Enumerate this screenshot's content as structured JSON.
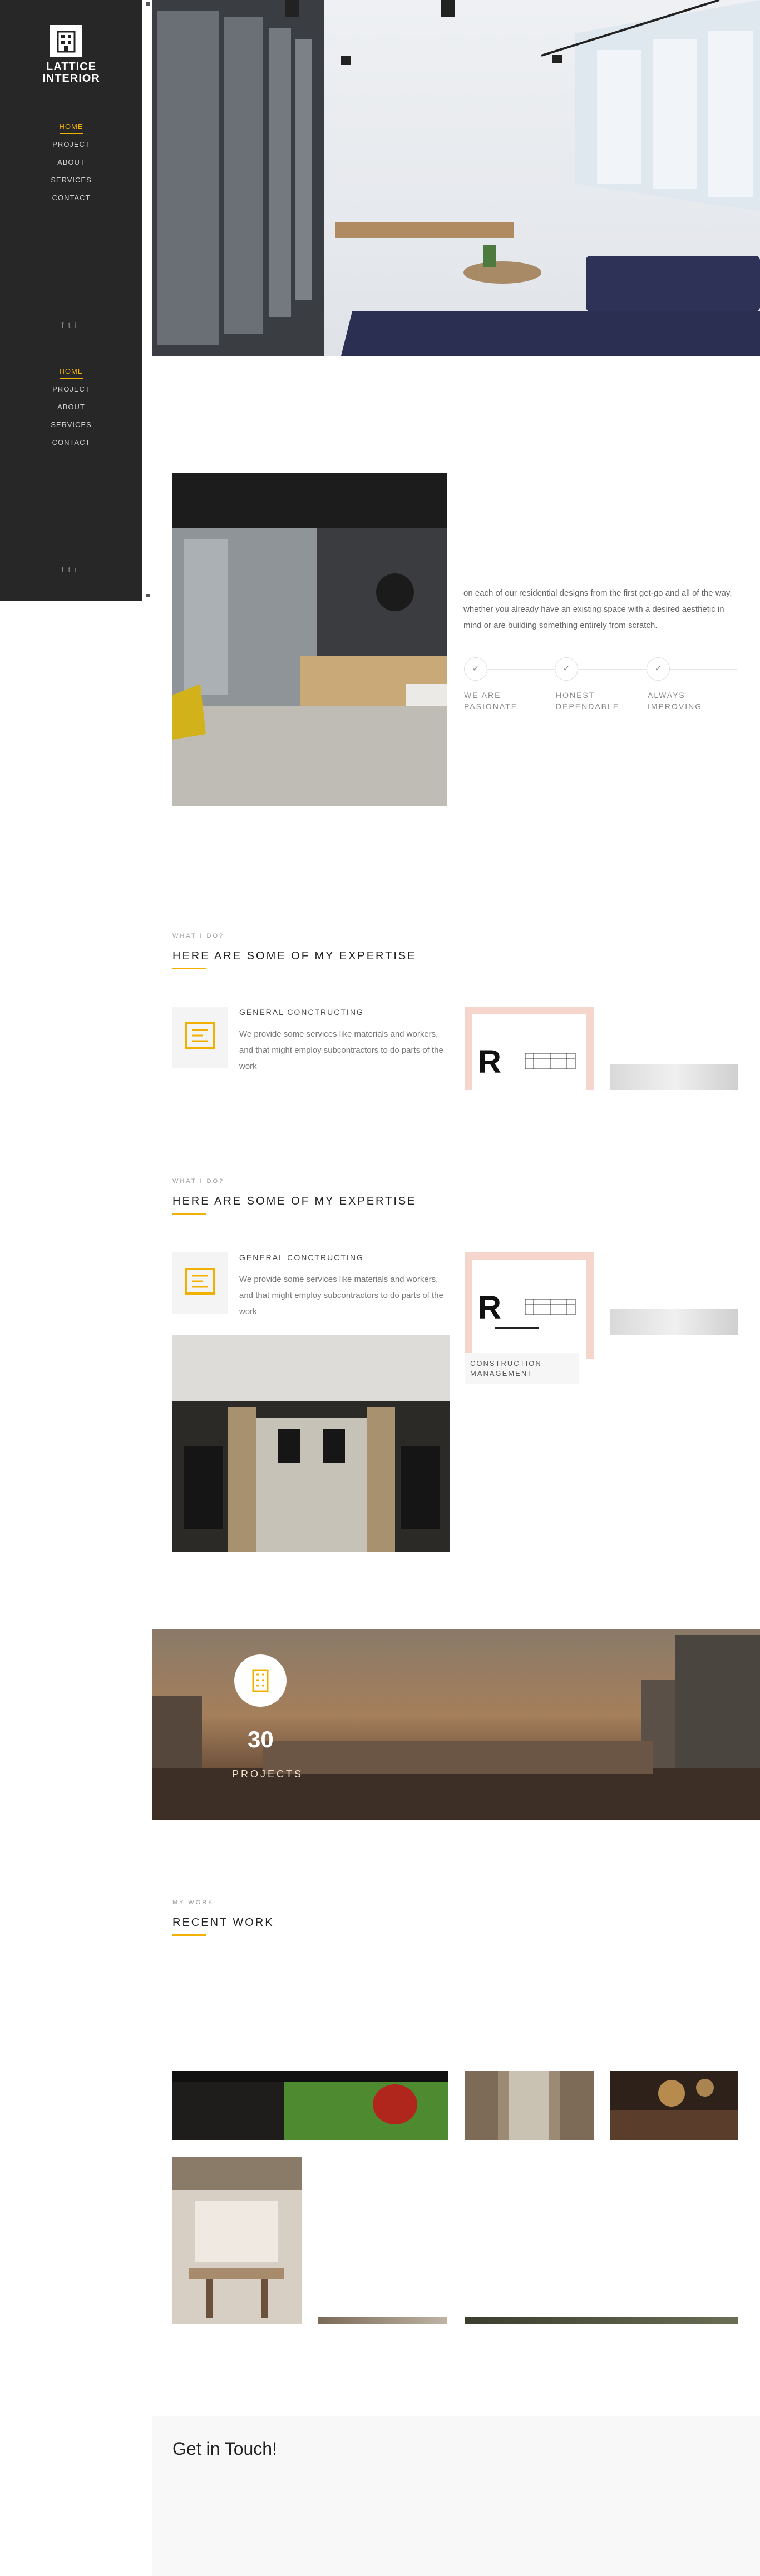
{
  "brand": {
    "line1": "LATTICE",
    "line2": "INTERIOR"
  },
  "nav": [
    "HOME",
    "PROJECT",
    "ABOUT",
    "SERVICES",
    "CONTACT"
  ],
  "nav_active": "HOME",
  "social": [
    "f",
    "t",
    "i"
  ],
  "about": {
    "text": "on each of our residential designs from the first get-go and all of the way, whether you already have an existing space with a desired aesthetic in mind or are building something entirely from scratch.",
    "features": [
      "WE ARE\nPASIONATE",
      "HONEST\nDEPENDABLE",
      "ALWAYS\nIMPROVING"
    ]
  },
  "expertise": {
    "kicker": "WHAT I DO?",
    "heading": "HERE ARE SOME OF MY EXPERTISE",
    "service_title": "GENERAL CONCTRUCTING",
    "service_text": "We provide some services like materials and workers, and that might employ subcontractors to do parts of the work",
    "card_caption": "CONSTRUCTION\nMANAGEMENT"
  },
  "counter": {
    "value": "30",
    "label": "PROJECTS"
  },
  "work": {
    "kicker": "MY WORK",
    "heading": "RECENT WORK"
  },
  "contact": {
    "title": "Get in Touch!"
  },
  "colors": {
    "accent": "#f2b000",
    "sidebar": "#272727",
    "card_border": "#f6d5cc"
  },
  "icons": [
    "logo-building-icon",
    "facebook-icon",
    "twitter-icon",
    "instagram-icon",
    "check-icon",
    "building-icon",
    "blueprint-icon"
  ]
}
